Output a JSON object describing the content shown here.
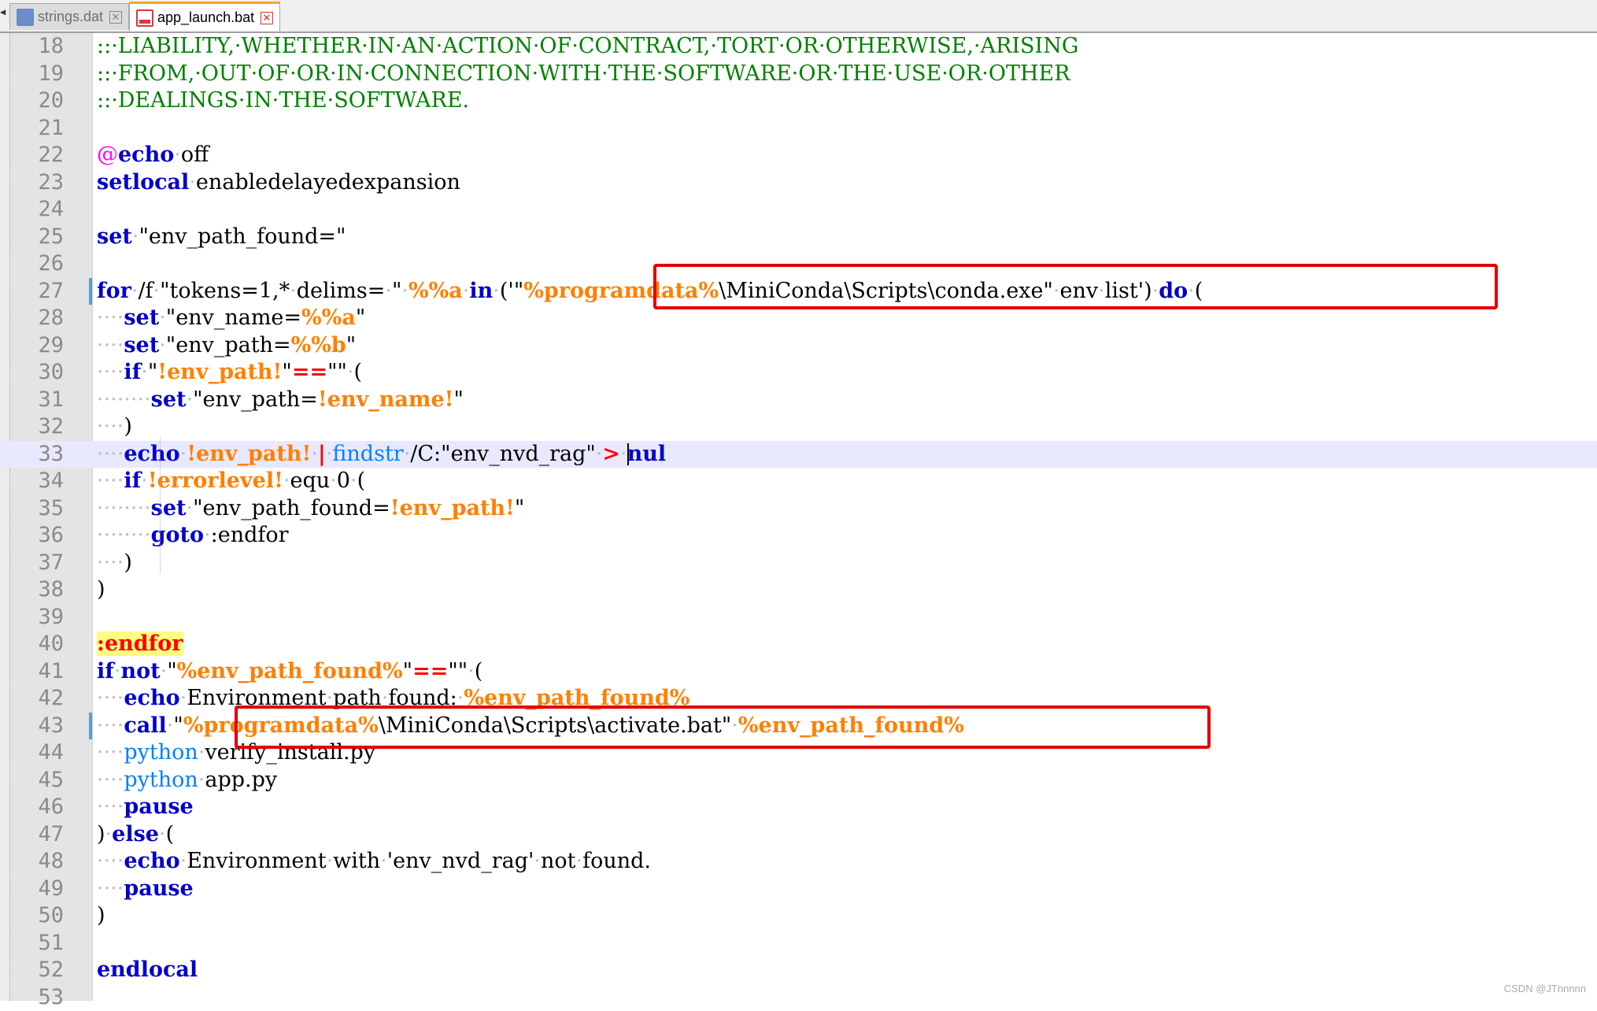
{
  "tabs": [
    {
      "label": "strings.dat",
      "active": false
    },
    {
      "label": "app_launch.bat",
      "active": true
    }
  ],
  "colors": {
    "comment": "#008000",
    "keyword": "#0000c8",
    "variable": "#ff8000",
    "operator": "#ff0000",
    "external": "#0080ff",
    "highlight_box": "#e00000",
    "label_bg": "#ffff80"
  },
  "icons": {
    "tab_file": "file-icon",
    "tab_close": "close-icon"
  },
  "editor": {
    "current_line": 33,
    "lines": [
      {
        "n": "18",
        "tokens": [
          [
            "cmt",
            "::·LIABILITY,·WHETHER·IN·AN·ACTION·OF·CONTRACT,·TORT·OR·OTHERWISE,·ARISING"
          ]
        ]
      },
      {
        "n": "19",
        "tokens": [
          [
            "cmt",
            "::·FROM,·OUT·OF·OR·IN·CONNECTION·WITH·THE·SOFTWARE·OR·THE·USE·OR·OTHER"
          ]
        ]
      },
      {
        "n": "20",
        "tokens": [
          [
            "cmt",
            "::·DEALINGS·IN·THE·SOFTWARE."
          ]
        ]
      },
      {
        "n": "21",
        "tokens": []
      },
      {
        "n": "22",
        "tokens": [
          [
            "at",
            "@"
          ],
          [
            "kw",
            "echo"
          ],
          [
            "dot",
            "·"
          ],
          [
            "",
            "off"
          ]
        ]
      },
      {
        "n": "23",
        "tokens": [
          [
            "kw",
            "setlocal"
          ],
          [
            "dot",
            "·"
          ],
          [
            "",
            "enabledelayedexpansion"
          ]
        ]
      },
      {
        "n": "24",
        "tokens": []
      },
      {
        "n": "25",
        "tokens": [
          [
            "kw",
            "set"
          ],
          [
            "dot",
            "·"
          ],
          [
            "",
            "\"env_path_found=\""
          ]
        ]
      },
      {
        "n": "26",
        "tokens": []
      },
      {
        "n": "27",
        "tokens": [
          [
            "kw",
            "for"
          ],
          [
            "dot",
            "·"
          ],
          [
            "",
            "/f"
          ],
          [
            "dot",
            "·"
          ],
          [
            "",
            "\"tokens=1,*"
          ],
          [
            "dot",
            "·"
          ],
          [
            "",
            "delims="
          ],
          [
            "dot",
            "·"
          ],
          [
            "",
            "\""
          ],
          [
            "dot",
            "·"
          ],
          [
            "var",
            "%%a"
          ],
          [
            "dot",
            "·"
          ],
          [
            "kw",
            "in"
          ],
          [
            "dot",
            "·"
          ],
          [
            "",
            "('\""
          ],
          [
            "var",
            "%programdata%"
          ],
          [
            "",
            "\\MiniConda\\Scripts\\conda.exe\""
          ],
          [
            "dot",
            "·"
          ],
          [
            "",
            "env"
          ],
          [
            "dot",
            "·"
          ],
          [
            "",
            "list')"
          ],
          [
            "dot",
            "·"
          ],
          [
            "kw",
            "do"
          ],
          [
            "dot",
            "·"
          ],
          [
            "",
            "("
          ]
        ]
      },
      {
        "n": "28",
        "tokens": [
          [
            "dot",
            "····"
          ],
          [
            "kw",
            "set"
          ],
          [
            "dot",
            "·"
          ],
          [
            "",
            "\"env_name="
          ],
          [
            "var",
            "%%a"
          ],
          [
            "",
            "\""
          ]
        ]
      },
      {
        "n": "29",
        "tokens": [
          [
            "dot",
            "····"
          ],
          [
            "kw",
            "set"
          ],
          [
            "dot",
            "·"
          ],
          [
            "",
            "\"env_path="
          ],
          [
            "var",
            "%%b"
          ],
          [
            "",
            "\""
          ]
        ]
      },
      {
        "n": "30",
        "tokens": [
          [
            "dot",
            "····"
          ],
          [
            "kw",
            "if"
          ],
          [
            "dot",
            "·"
          ],
          [
            "",
            "\""
          ],
          [
            "var",
            "!env_path!"
          ],
          [
            "",
            "\""
          ],
          [
            "op",
            "=="
          ],
          [
            "",
            "\"\""
          ],
          [
            "dot",
            "·"
          ],
          [
            "",
            "("
          ]
        ]
      },
      {
        "n": "31",
        "tokens": [
          [
            "dot",
            "········"
          ],
          [
            "kw",
            "set"
          ],
          [
            "dot",
            "·"
          ],
          [
            "",
            "\"env_path="
          ],
          [
            "var",
            "!env_name!"
          ],
          [
            "",
            "\""
          ]
        ]
      },
      {
        "n": "32",
        "tokens": [
          [
            "dot",
            "····"
          ],
          [
            "",
            ")"
          ]
        ]
      },
      {
        "n": "33",
        "tokens": [
          [
            "dot",
            "····"
          ],
          [
            "kw",
            "echo"
          ],
          [
            "dot",
            "·"
          ],
          [
            "var",
            "!env_path!"
          ],
          [
            "dot",
            "·"
          ],
          [
            "op",
            "|"
          ],
          [
            "dot",
            "·"
          ],
          [
            "ext",
            "findstr"
          ],
          [
            "dot",
            "·"
          ],
          [
            "",
            "/C:\"env_nvd_rag\""
          ],
          [
            "dot",
            "·"
          ],
          [
            "op",
            ">"
          ],
          [
            "dot",
            "·"
          ],
          [
            "caret",
            ""
          ],
          [
            "kw",
            "nul"
          ]
        ]
      },
      {
        "n": "34",
        "tokens": [
          [
            "dot",
            "····"
          ],
          [
            "kw",
            "if"
          ],
          [
            "dot",
            "·"
          ],
          [
            "var",
            "!errorlevel!"
          ],
          [
            "dot",
            "·"
          ],
          [
            "",
            "equ"
          ],
          [
            "dot",
            "·"
          ],
          [
            "",
            "0"
          ],
          [
            "dot",
            "·"
          ],
          [
            "",
            "("
          ]
        ]
      },
      {
        "n": "35",
        "tokens": [
          [
            "dot",
            "········"
          ],
          [
            "kw",
            "set"
          ],
          [
            "dot",
            "·"
          ],
          [
            "",
            "\"env_path_found="
          ],
          [
            "var",
            "!env_path!"
          ],
          [
            "",
            "\""
          ]
        ]
      },
      {
        "n": "36",
        "tokens": [
          [
            "dot",
            "········"
          ],
          [
            "kw",
            "goto"
          ],
          [
            "dot",
            "·"
          ],
          [
            "",
            ":endfor"
          ]
        ]
      },
      {
        "n": "37",
        "tokens": [
          [
            "dot",
            "····"
          ],
          [
            "",
            ")"
          ]
        ]
      },
      {
        "n": "38",
        "tokens": [
          [
            "",
            ")"
          ]
        ]
      },
      {
        "n": "39",
        "tokens": []
      },
      {
        "n": "40",
        "tokens": [
          [
            "lbl",
            ":endfor"
          ]
        ]
      },
      {
        "n": "41",
        "tokens": [
          [
            "kw",
            "if"
          ],
          [
            "dot",
            "·"
          ],
          [
            "kw",
            "not"
          ],
          [
            "dot",
            "·"
          ],
          [
            "",
            "\""
          ],
          [
            "var",
            "%env_path_found%"
          ],
          [
            "",
            "\""
          ],
          [
            "op",
            "=="
          ],
          [
            "",
            "\"\""
          ],
          [
            "dot",
            "·"
          ],
          [
            "",
            "("
          ]
        ]
      },
      {
        "n": "42",
        "tokens": [
          [
            "dot",
            "····"
          ],
          [
            "kw",
            "echo"
          ],
          [
            "dot",
            "·"
          ],
          [
            "",
            "Environment"
          ],
          [
            "dot",
            "·"
          ],
          [
            "",
            "path"
          ],
          [
            "dot",
            "·"
          ],
          [
            "",
            "found:"
          ],
          [
            "dot",
            "·"
          ],
          [
            "var",
            "%env_path_found%"
          ]
        ]
      },
      {
        "n": "43",
        "tokens": [
          [
            "dot",
            "····"
          ],
          [
            "kw",
            "call"
          ],
          [
            "dot",
            "·"
          ],
          [
            "",
            "\""
          ],
          [
            "var",
            "%programdata%"
          ],
          [
            "",
            "\\MiniConda\\Scripts\\activate.bat\""
          ],
          [
            "dot",
            "·"
          ],
          [
            "var",
            "%env_path_found%"
          ]
        ]
      },
      {
        "n": "44",
        "tokens": [
          [
            "dot",
            "····"
          ],
          [
            "ext",
            "python"
          ],
          [
            "dot",
            "·"
          ],
          [
            "",
            "verify_install.py"
          ]
        ]
      },
      {
        "n": "45",
        "tokens": [
          [
            "dot",
            "····"
          ],
          [
            "ext",
            "python"
          ],
          [
            "dot",
            "·"
          ],
          [
            "",
            "app.py"
          ]
        ]
      },
      {
        "n": "46",
        "tokens": [
          [
            "dot",
            "····"
          ],
          [
            "kw",
            "pause"
          ]
        ]
      },
      {
        "n": "47",
        "tokens": [
          [
            "",
            ")"
          ],
          [
            "dot",
            "·"
          ],
          [
            "kw",
            "else"
          ],
          [
            "dot",
            "·"
          ],
          [
            "",
            "("
          ]
        ]
      },
      {
        "n": "48",
        "tokens": [
          [
            "dot",
            "····"
          ],
          [
            "kw",
            "echo"
          ],
          [
            "dot",
            "·"
          ],
          [
            "",
            "Environment"
          ],
          [
            "dot",
            "·"
          ],
          [
            "",
            "with"
          ],
          [
            "dot",
            "·"
          ],
          [
            "",
            "'env_nvd_rag'"
          ],
          [
            "dot",
            "·"
          ],
          [
            "",
            "not"
          ],
          [
            "dot",
            "·"
          ],
          [
            "",
            "found."
          ]
        ]
      },
      {
        "n": "49",
        "tokens": [
          [
            "dot",
            "····"
          ],
          [
            "kw",
            "pause"
          ]
        ]
      },
      {
        "n": "50",
        "tokens": [
          [
            "",
            ")"
          ]
        ]
      },
      {
        "n": "51",
        "tokens": []
      },
      {
        "n": "52",
        "tokens": [
          [
            "kw",
            "endlocal"
          ]
        ]
      },
      {
        "n": "53",
        "tokens": []
      }
    ]
  },
  "watermark": "CSDN @JTnnnnn"
}
